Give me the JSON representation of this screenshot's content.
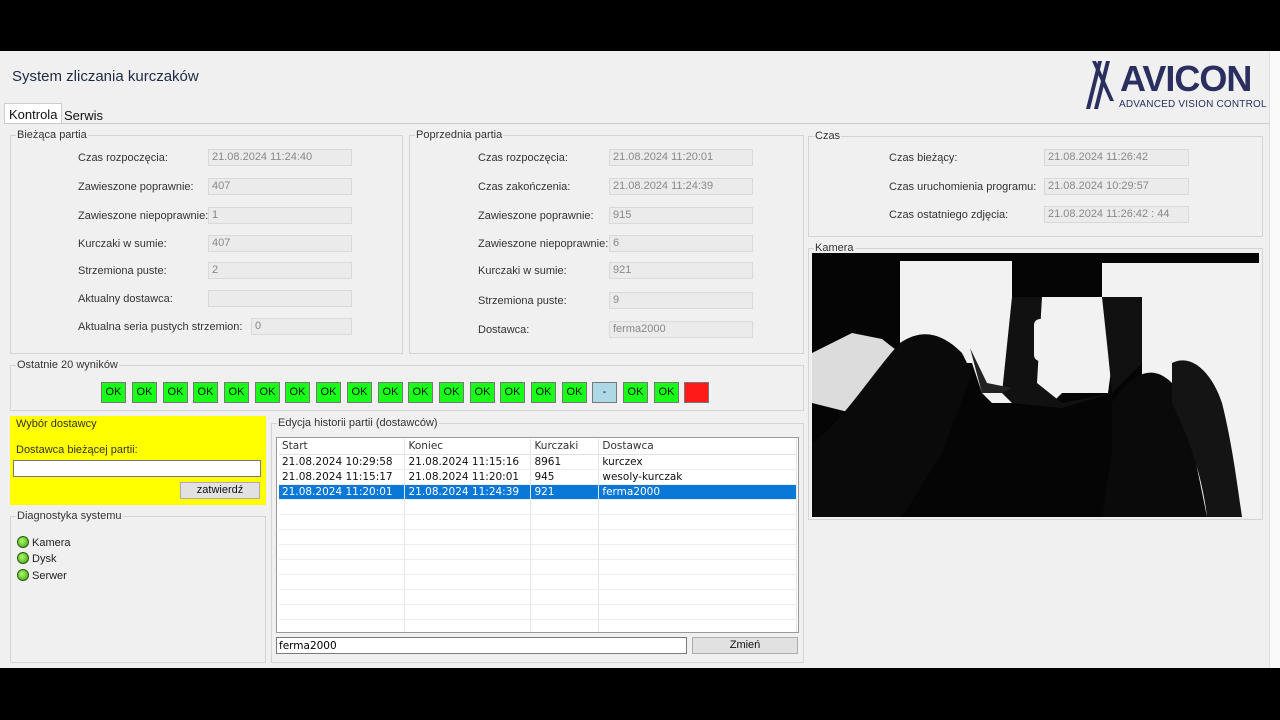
{
  "app": {
    "title": "System zliczania kurczaków"
  },
  "logo": {
    "brand": "AVICON",
    "tagline": "ADVANCED VISION CONTROL"
  },
  "tabs": [
    {
      "label": "Kontrola",
      "active": true
    },
    {
      "label": "Serwis",
      "active": false
    }
  ],
  "current_batch": {
    "title": "Bieżąca partia",
    "rows": [
      {
        "label": "Czas rozpoczęcia:",
        "value": "21.08.2024 11:24:40"
      },
      {
        "label": "Zawieszone poprawnie:",
        "value": "407"
      },
      {
        "label": "Zawieszone niepoprawnie:",
        "value": "1"
      },
      {
        "label": "Kurczaki w sumie:",
        "value": "407"
      },
      {
        "label": "Strzemiona puste:",
        "value": "2"
      },
      {
        "label": "Aktualny dostawca:",
        "value": ""
      },
      {
        "label": "Aktualna seria pustych strzemion:",
        "value": "0"
      }
    ]
  },
  "previous_batch": {
    "title": "Poprzednia partia",
    "rows": [
      {
        "label": "Czas rozpoczęcia:",
        "value": "21.08.2024 11:20:01"
      },
      {
        "label": "Czas zakończenia:",
        "value": "21.08.2024 11:24:39"
      },
      {
        "label": "Zawieszone poprawnie:",
        "value": "915"
      },
      {
        "label": "Zawieszone niepoprawnie:",
        "value": "6"
      },
      {
        "label": "Kurczaki w sumie:",
        "value": "921"
      },
      {
        "label": "Strzemiona puste:",
        "value": "9"
      },
      {
        "label": "Dostawca:",
        "value": "ferma2000"
      }
    ]
  },
  "time": {
    "title": "Czas",
    "rows": [
      {
        "label": "Czas bieżący:",
        "value": "21.08.2024 11:26:42"
      },
      {
        "label": "Czas uruchomienia programu:",
        "value": "21.08.2024 10:29:57"
      },
      {
        "label": "Czas ostatniego zdjęcia:",
        "value": "21.08.2024 11:26:42 : 44"
      }
    ]
  },
  "last_results": {
    "title": "Ostatnie 20 wyników",
    "items": [
      "OK",
      "OK",
      "OK",
      "OK",
      "OK",
      "OK",
      "OK",
      "OK",
      "OK",
      "OK",
      "OK",
      "OK",
      "OK",
      "OK",
      "OK",
      "OK",
      "-",
      "OK",
      "OK",
      ""
    ],
    "colors": {
      "ok": "#18ff18",
      "empty": "#add8e6",
      "fail": "#ff1a1a"
    }
  },
  "supplier_select": {
    "title": "Wybór dostawcy",
    "label": "Dostawca bieżącej partii:",
    "value": "",
    "confirm_label": "zatwierdź",
    "background": "#ffff00"
  },
  "diagnostics": {
    "title": "Diagnostyka systemu",
    "items": [
      "Kamera",
      "Dysk",
      "Serwer"
    ]
  },
  "history": {
    "title": "Edycja historii partii (dostawców)",
    "columns": [
      "Start",
      "Koniec",
      "Kurczaki",
      "Dostawca"
    ],
    "rows": [
      [
        "21.08.2024 10:29:58",
        "21.08.2024 11:15:16",
        "8961",
        "kurczex"
      ],
      [
        "21.08.2024 11:15:17",
        "21.08.2024 11:20:01",
        "945",
        "wesoly-kurczak"
      ],
      [
        "21.08.2024 11:20:01",
        "21.08.2024 11:24:39",
        "921",
        "ferma2000"
      ]
    ],
    "selected_row": 2,
    "edit_value": "ferma2000",
    "change_label": "Zmień"
  },
  "camera": {
    "title": "Kamera"
  }
}
